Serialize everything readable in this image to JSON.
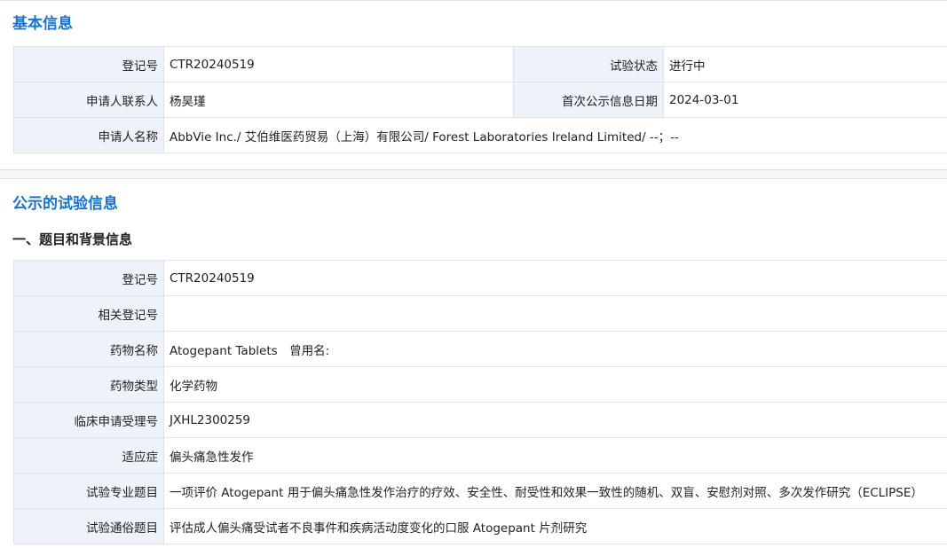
{
  "basic_info": {
    "title": "基本信息",
    "reg_no_label": "登记号",
    "reg_no_value": "CTR20240519",
    "trial_status_label": "试验状态",
    "trial_status_value": "进行中",
    "contact_label": "申请人联系人",
    "contact_value": "杨昊瑾",
    "first_pub_date_label": "首次公示信息日期",
    "first_pub_date_value": "2024-03-01",
    "applicant_name_label": "申请人名称",
    "applicant_name_value": "AbbVie Inc./ 艾伯维医药贸易（上海）有限公司/ Forest Laboratories Ireland Limited/ --；--"
  },
  "trial_info": {
    "title": "公示的试验信息",
    "subsection_title": "一、题目和背景信息",
    "rows": [
      {
        "label": "登记号",
        "value": "CTR20240519"
      },
      {
        "label": "相关登记号",
        "value": ""
      },
      {
        "label": "药物名称",
        "value": "Atogepant Tablets　曾用名:"
      },
      {
        "label": "药物类型",
        "value": "化学药物"
      },
      {
        "label": "临床申请受理号",
        "value": "JXHL2300259"
      },
      {
        "label": "适应症",
        "value": "偏头痛急性发作"
      },
      {
        "label": "试验专业题目",
        "value": "一项评价 Atogepant 用于偏头痛急性发作治疗的疗效、安全性、耐受性和效果一致性的随机、双盲、安慰剂对照、多次发作研究（ECLIPSE）"
      },
      {
        "label": "试验通俗题目",
        "value": "评估成人偏头痛受试者不良事件和疾病活动度变化的口服 Atogepant 片剂研究"
      }
    ]
  }
}
